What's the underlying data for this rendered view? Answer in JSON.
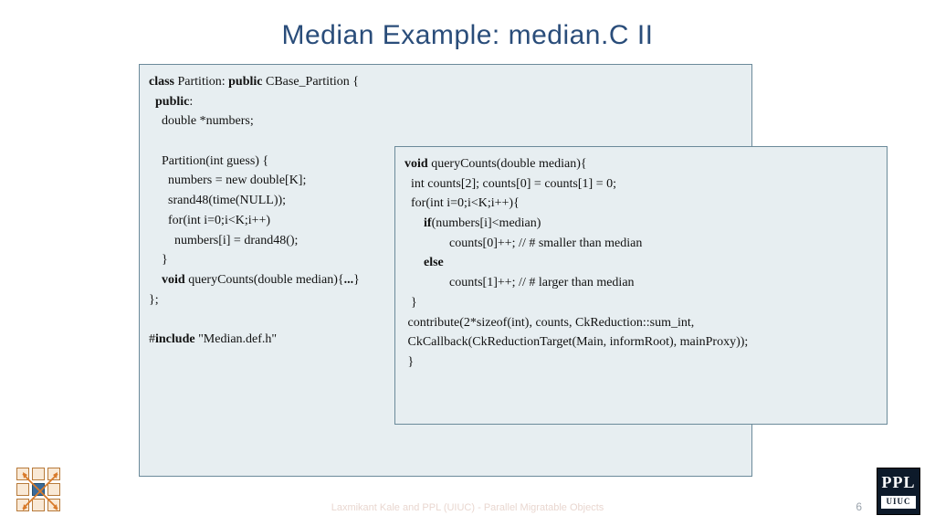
{
  "title": "Median Example: median.C II",
  "code_left": [
    {
      "t": "code",
      "segs": [
        {
          "k": 1,
          "v": "class "
        },
        {
          "v": "Partition: "
        },
        {
          "k": 1,
          "v": "public "
        },
        {
          "v": "CBase_Partition {"
        }
      ]
    },
    {
      "t": "code",
      "segs": [
        {
          "v": "  "
        },
        {
          "k": 1,
          "v": "public"
        },
        {
          "v": ":"
        }
      ]
    },
    {
      "t": "code",
      "segs": [
        {
          "v": "    double *numbers;"
        }
      ]
    },
    {
      "t": "code",
      "segs": [
        {
          "v": ""
        }
      ]
    },
    {
      "t": "code",
      "segs": [
        {
          "v": "    Partition(int guess) {"
        }
      ]
    },
    {
      "t": "code",
      "segs": [
        {
          "v": "      numbers = new double[K];"
        }
      ]
    },
    {
      "t": "code",
      "segs": [
        {
          "v": "      srand48(time(NULL));"
        }
      ]
    },
    {
      "t": "code",
      "segs": [
        {
          "v": "      for(int i=0;i<K;i++)"
        }
      ]
    },
    {
      "t": "code",
      "segs": [
        {
          "v": "        numbers[i] = drand48();"
        }
      ]
    },
    {
      "t": "code",
      "segs": [
        {
          "v": "    }"
        }
      ]
    },
    {
      "t": "code",
      "segs": [
        {
          "v": "    "
        },
        {
          "k": 1,
          "v": "void "
        },
        {
          "v": "queryCounts(double median){"
        },
        {
          "k": 1,
          "v": "..."
        },
        {
          "v": "}"
        }
      ]
    },
    {
      "t": "code",
      "segs": [
        {
          "v": "};"
        }
      ]
    },
    {
      "t": "code",
      "segs": [
        {
          "v": ""
        }
      ]
    },
    {
      "t": "code",
      "segs": [
        {
          "v": "#"
        },
        {
          "k": 1,
          "v": "include"
        },
        {
          "v": " \"Median.def.h\""
        }
      ]
    }
  ],
  "code_right": [
    {
      "t": "code",
      "segs": [
        {
          "k": 1,
          "v": "void "
        },
        {
          "v": "queryCounts(double median){"
        }
      ]
    },
    {
      "t": "code",
      "segs": [
        {
          "v": "  int counts[2]; counts[0] = counts[1] = 0;"
        }
      ]
    },
    {
      "t": "code",
      "segs": [
        {
          "v": "  for(int i=0;i<K;i++){"
        }
      ]
    },
    {
      "t": "code",
      "segs": [
        {
          "v": "      "
        },
        {
          "k": 1,
          "v": "if"
        },
        {
          "v": "(numbers[i]<median)"
        }
      ]
    },
    {
      "t": "code",
      "segs": [
        {
          "v": "              counts[0]++; // # smaller than median"
        }
      ]
    },
    {
      "t": "code",
      "segs": [
        {
          "v": "      "
        },
        {
          "k": 1,
          "v": "else"
        }
      ]
    },
    {
      "t": "code",
      "segs": [
        {
          "v": "              counts[1]++; // # larger than median"
        }
      ]
    },
    {
      "t": "code",
      "segs": [
        {
          "v": "  }"
        }
      ]
    },
    {
      "t": "code",
      "segs": [
        {
          "v": " contribute(2*sizeof(int), counts, CkReduction::sum_int,"
        }
      ]
    },
    {
      "t": "code",
      "segs": [
        {
          "v": " CkCallback(CkReductionTarget(Main, informRoot), mainProxy));"
        }
      ]
    },
    {
      "t": "code",
      "segs": [
        {
          "v": " }"
        }
      ]
    }
  ],
  "footer": "Laxmikant Kale and PPL (UIUC) - Parallel Migratable Objects",
  "page": "6",
  "logo_right": {
    "line1": "PPL",
    "line2": "UIUC"
  }
}
